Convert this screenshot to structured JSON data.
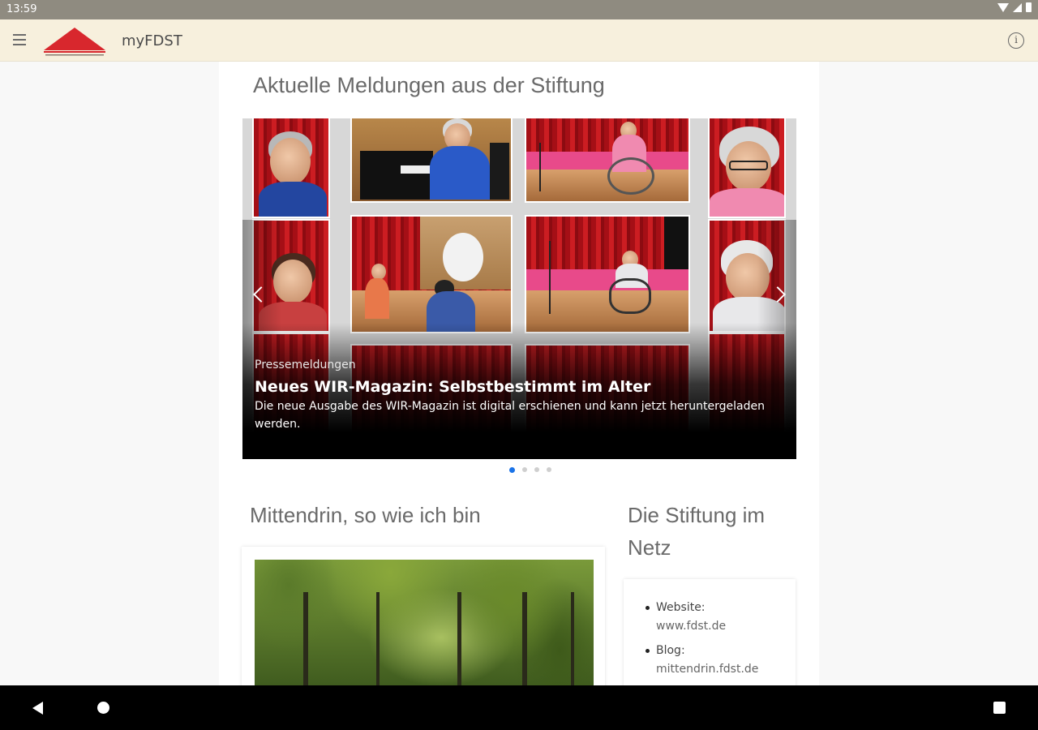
{
  "status_bar": {
    "time": "13:59"
  },
  "app_bar": {
    "title": "myFDST"
  },
  "news": {
    "title": "Aktuelle Meldungen aus der Stiftung",
    "slide": {
      "category": "Pressemeldungen",
      "headline": "Neues WIR-Magazin: Selbstbestimmt im Alter",
      "text": "Die neue Ausgabe des WIR-Magazin ist digital erschienen und kann jetzt heruntergeladen werden."
    },
    "pager": {
      "count": 4,
      "active": 1
    }
  },
  "feature": {
    "title": "Mittendrin, so wie ich bin"
  },
  "netz": {
    "title": "Die Stiftung im Netz",
    "links": [
      {
        "label": "Website:",
        "url": "www.fdst.de"
      },
      {
        "label": "Blog:",
        "url": "mittendrin.fdst.de"
      }
    ]
  },
  "colors": {
    "app_bar": "#f7f0dd",
    "status_bar": "#8f8b80",
    "logo_red": "#d8272d",
    "pager_active": "#1a73e8"
  }
}
